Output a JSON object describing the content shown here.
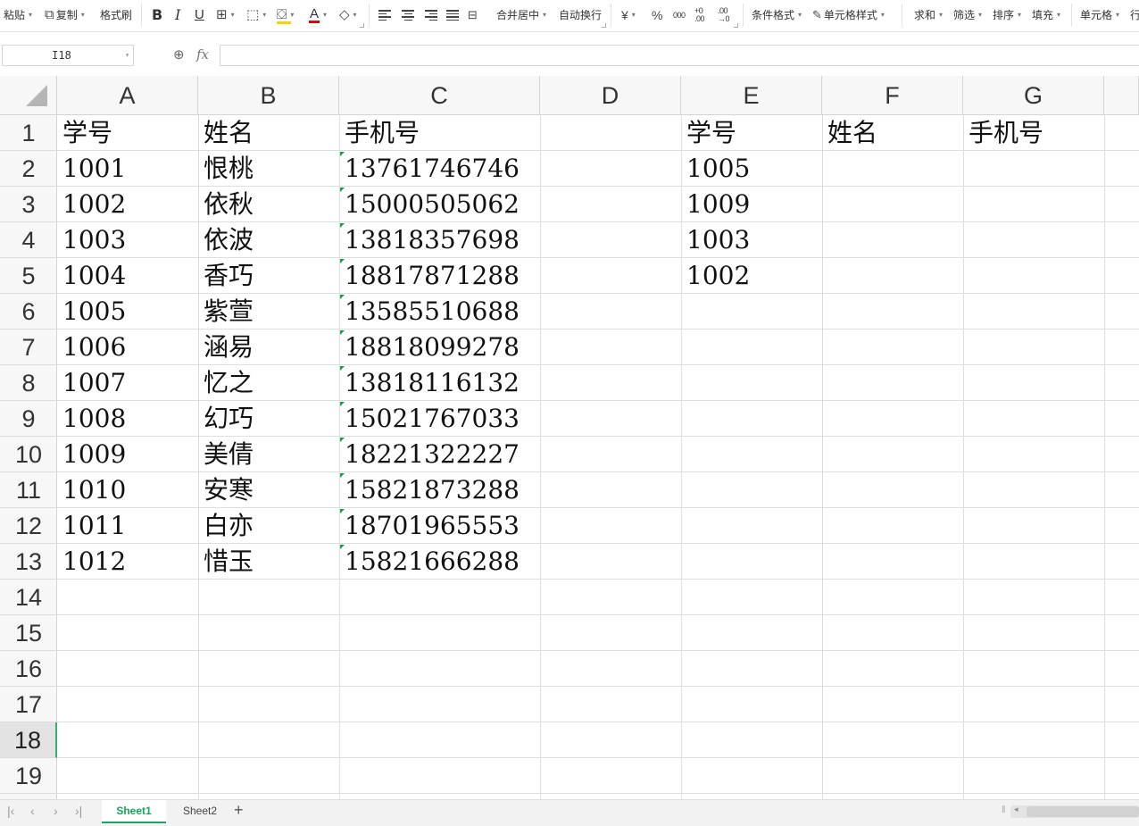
{
  "toolbar": {
    "paste": "粘贴",
    "copy": "复制",
    "format_painter": "格式刷",
    "merge_center": "合并居中",
    "wrap_text": "自动换行",
    "currency": "¥",
    "percent": "%",
    "thousands": "000",
    "dec_increase": "+0 .00",
    "dec_decrease": ".00 →0",
    "conditional_format": "条件格式",
    "cell_style": "单元格样式",
    "sum": "求和",
    "filter": "筛选",
    "sort": "排序",
    "fill": "填充",
    "cell": "单元格",
    "row_col": "行",
    "bold": "B",
    "italic": "I",
    "underline": "U",
    "font_color_glyph": "A",
    "font_color": "#e00000",
    "fill_color": "#f5d400"
  },
  "formula_bar": {
    "name_box": "I18",
    "fx": "fx",
    "formula": ""
  },
  "columns": [
    {
      "label": "A"
    },
    {
      "label": "B"
    },
    {
      "label": "C"
    },
    {
      "label": "D"
    },
    {
      "label": "E"
    },
    {
      "label": "F"
    },
    {
      "label": "G"
    }
  ],
  "rows": [
    "1",
    "2",
    "3",
    "4",
    "5",
    "6",
    "7",
    "8",
    "9",
    "10",
    "11",
    "12",
    "13",
    "14",
    "15",
    "16",
    "17",
    "18",
    "19"
  ],
  "active_row": "18",
  "cells": {
    "A": [
      "学号",
      "1001",
      "1002",
      "1003",
      "1004",
      "1005",
      "1006",
      "1007",
      "1008",
      "1009",
      "1010",
      "1011",
      "1012"
    ],
    "B": [
      "姓名",
      "恨桃",
      "依秋",
      "依波",
      "香巧",
      "紫萱",
      "涵易",
      "忆之",
      "幻巧",
      "美倩",
      "安寒",
      "白亦",
      "惜玉"
    ],
    "C": [
      "手机号",
      "13761746746",
      "15000505062",
      "13818357698",
      "18817871288",
      "13585510688",
      "18818099278",
      "13818116132",
      "15021767033",
      "18221322227",
      "15821873288",
      "18701965553",
      "15821666288"
    ],
    "E": [
      "学号",
      "1005",
      "1009",
      "1003",
      "1002"
    ],
    "F": [
      "姓名"
    ],
    "G": [
      "手机号"
    ]
  },
  "accent_color": "#1aa260",
  "sheets": [
    {
      "name": "Sheet1",
      "active": true
    },
    {
      "name": "Sheet2",
      "active": false
    }
  ],
  "add_sheet": "+"
}
